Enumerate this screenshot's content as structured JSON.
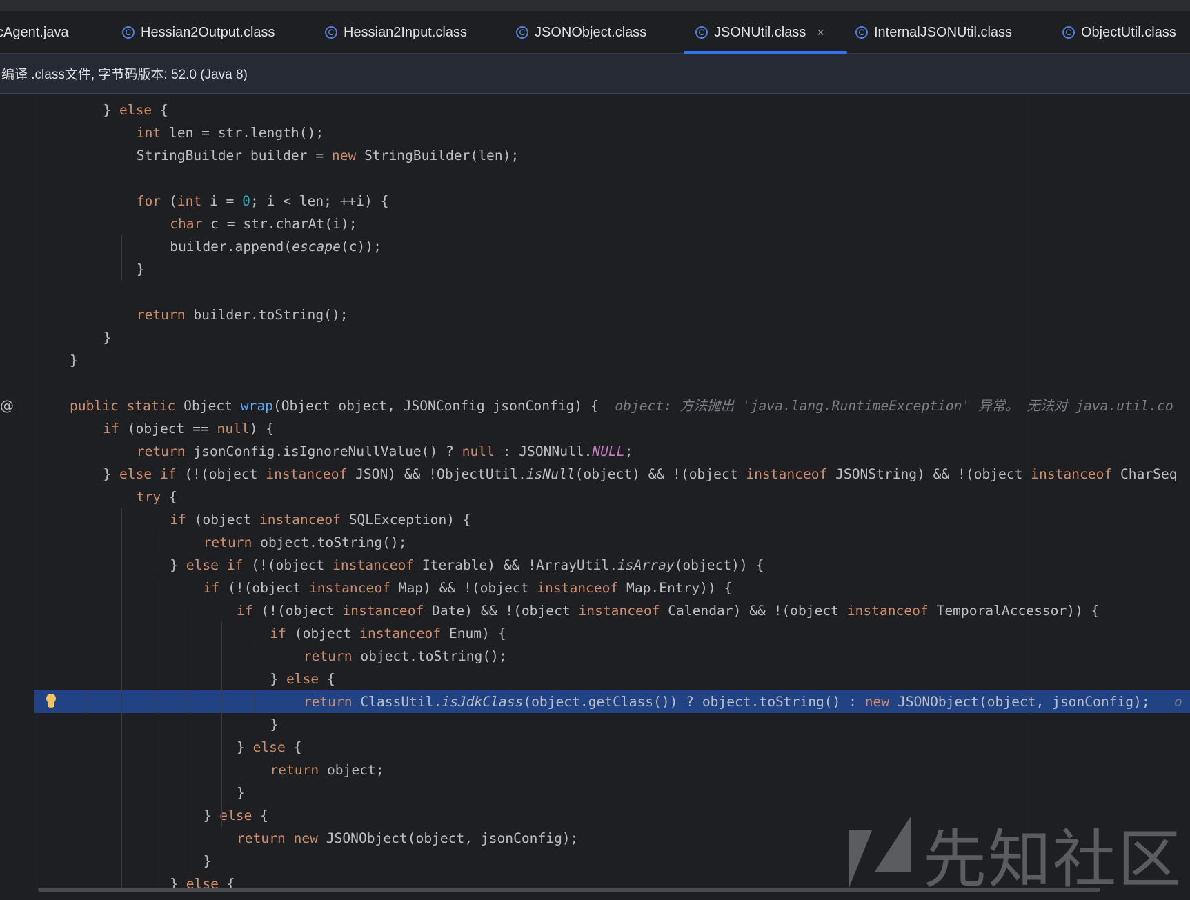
{
  "tabs": [
    {
      "label": "cAgent.java",
      "icon": "none"
    },
    {
      "label": "Hessian2Output.class",
      "icon": "class-icon"
    },
    {
      "label": "Hessian2Input.class",
      "icon": "class-icon"
    },
    {
      "label": "JSONObject.class",
      "icon": "class-icon"
    },
    {
      "label": "JSONUtil.class",
      "icon": "class-icon",
      "active": true,
      "close": "×"
    },
    {
      "label": "InternalJSONUtil.class",
      "icon": "class-icon"
    },
    {
      "label": "ObjectUtil.class",
      "icon": "class-icon"
    }
  ],
  "banner": {
    "text": "编译 .class文件, 字节码版本: 52.0 (Java 8)"
  },
  "editor": {
    "gutter_marker": "@",
    "lines": [
      [
        [
          "p",
          "} "
        ],
        [
          "kw",
          "else"
        ],
        [
          "p",
          " {"
        ]
      ],
      [
        [
          "kw",
          "int"
        ],
        [
          "p",
          " len = str.length();"
        ]
      ],
      [
        [
          "p",
          "StringBuilder builder = "
        ],
        [
          "kw",
          "new"
        ],
        [
          "p",
          " StringBuilder(len);"
        ]
      ],
      [],
      [
        [
          "kw",
          "for"
        ],
        [
          "p",
          " ("
        ],
        [
          "kw",
          "int"
        ],
        [
          "p",
          " i = "
        ],
        [
          "num",
          "0"
        ],
        [
          "p",
          "; i < len; ++i) {"
        ]
      ],
      [
        [
          "kw",
          "char"
        ],
        [
          "p",
          " c = str.charAt(i);"
        ]
      ],
      [
        [
          "p",
          "builder.append("
        ],
        [
          "it",
          "escape"
        ],
        [
          "p",
          "(c));"
        ]
      ],
      [
        [
          "p",
          "}"
        ]
      ],
      [],
      [
        [
          "kw",
          "return"
        ],
        [
          "p",
          " builder.toString();"
        ]
      ],
      [
        [
          "p",
          "}"
        ]
      ],
      [
        [
          "p",
          "}"
        ]
      ],
      [],
      [
        [
          "kw",
          "public static"
        ],
        [
          "p",
          " Object "
        ],
        [
          "fn",
          "wrap"
        ],
        [
          "p",
          "(Object object, JSONConfig jsonConfig) {  "
        ],
        [
          "hint",
          "object: 方法抛出 'java.lang.RuntimeException' 异常。 无法对 java.util.co"
        ]
      ],
      [
        [
          "kw",
          "if"
        ],
        [
          "p",
          " (object == "
        ],
        [
          "kw",
          "null"
        ],
        [
          "p",
          ") {"
        ]
      ],
      [
        [
          "kw",
          "return"
        ],
        [
          "p",
          " jsonConfig.isIgnoreNullValue() ? "
        ],
        [
          "kw",
          "null"
        ],
        [
          "p",
          " : JSONNull."
        ],
        [
          "stc",
          "NULL"
        ],
        [
          "p",
          ";"
        ]
      ],
      [
        [
          "p",
          "} "
        ],
        [
          "kw",
          "else if"
        ],
        [
          "p",
          " (!(object "
        ],
        [
          "kw",
          "instanceof"
        ],
        [
          "p",
          " JSON) && !ObjectUtil."
        ],
        [
          "it",
          "isNull"
        ],
        [
          "p",
          "(object) && !(object "
        ],
        [
          "kw",
          "instanceof"
        ],
        [
          "p",
          " JSONString) && !(object "
        ],
        [
          "kw",
          "instanceof"
        ],
        [
          "p",
          " CharSeq"
        ]
      ],
      [
        [
          "kw",
          "try"
        ],
        [
          "p",
          " {"
        ]
      ],
      [
        [
          "kw",
          "if"
        ],
        [
          "p",
          " (object "
        ],
        [
          "kw",
          "instanceof"
        ],
        [
          "p",
          " SQLException) {"
        ]
      ],
      [
        [
          "kw",
          "return"
        ],
        [
          "p",
          " object.toString();"
        ]
      ],
      [
        [
          "p",
          "} "
        ],
        [
          "kw",
          "else if"
        ],
        [
          "p",
          " (!(object "
        ],
        [
          "kw",
          "instanceof"
        ],
        [
          "p",
          " Iterable) && !ArrayUtil."
        ],
        [
          "it",
          "isArray"
        ],
        [
          "p",
          "(object)) {"
        ]
      ],
      [
        [
          "kw",
          "if"
        ],
        [
          "p",
          " (!(object "
        ],
        [
          "kw",
          "instanceof"
        ],
        [
          "p",
          " Map) && !(object "
        ],
        [
          "kw",
          "instanceof"
        ],
        [
          "p",
          " Map.Entry)) {"
        ]
      ],
      [
        [
          "kw",
          "if"
        ],
        [
          "p",
          " (!(object "
        ],
        [
          "kw",
          "instanceof"
        ],
        [
          "p",
          " Date) && !(object "
        ],
        [
          "kw",
          "instanceof"
        ],
        [
          "p",
          " Calendar) && !(object "
        ],
        [
          "kw",
          "instanceof"
        ],
        [
          "p",
          " TemporalAccessor)) {"
        ]
      ],
      [
        [
          "kw",
          "if"
        ],
        [
          "p",
          " (object "
        ],
        [
          "kw",
          "instanceof"
        ],
        [
          "p",
          " Enum) {"
        ]
      ],
      [
        [
          "kw",
          "return"
        ],
        [
          "p",
          " object.toString();"
        ]
      ],
      [
        [
          "p",
          "} "
        ],
        [
          "kw",
          "else"
        ],
        [
          "p",
          " {"
        ]
      ],
      [
        [
          "kw",
          "return"
        ],
        [
          "p",
          " ClassUtil."
        ],
        [
          "it",
          "isJdkClass"
        ],
        [
          "p",
          "(object.getClass()) ? object.toString() : "
        ],
        [
          "kw",
          "new"
        ],
        [
          "p",
          " JSONObject(object, jsonConfig);   "
        ],
        [
          "hint",
          "o"
        ]
      ],
      [
        [
          "p",
          "}"
        ]
      ],
      [
        [
          "p",
          "} "
        ],
        [
          "kw",
          "else"
        ],
        [
          "p",
          " {"
        ]
      ],
      [
        [
          "kw",
          "return"
        ],
        [
          "p",
          " object;"
        ]
      ],
      [
        [
          "p",
          "}"
        ]
      ],
      [
        [
          "p",
          "} "
        ],
        [
          "kw",
          "else"
        ],
        [
          "p",
          " {"
        ]
      ],
      [
        [
          "kw",
          "return new"
        ],
        [
          "p",
          " JSONObject(object, jsonConfig);"
        ]
      ],
      [
        [
          "p",
          "}"
        ]
      ],
      [
        [
          "p",
          "} "
        ],
        [
          "kw",
          "else"
        ],
        [
          "p",
          " {"
        ]
      ]
    ]
  },
  "watermark": {
    "text": "先知社区"
  }
}
